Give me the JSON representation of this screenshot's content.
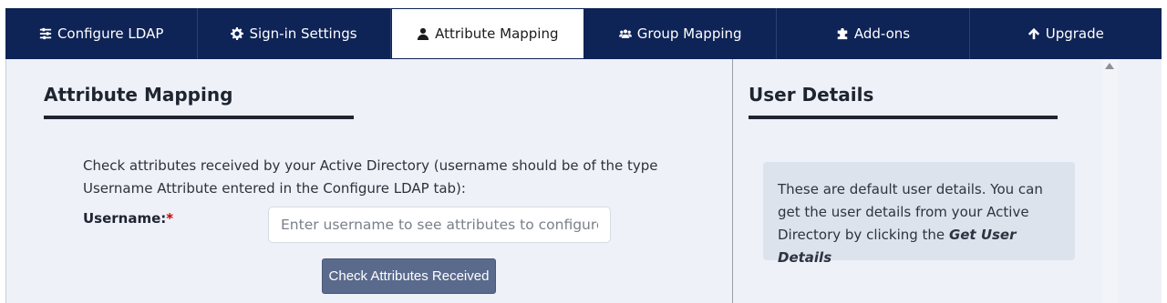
{
  "tabs": [
    {
      "label": "Configure LDAP",
      "icon": "sliders-icon"
    },
    {
      "label": "Sign-in Settings",
      "icon": "gear-icon"
    },
    {
      "label": "Attribute Mapping",
      "icon": "user-icon"
    },
    {
      "label": "Group Mapping",
      "icon": "users-icon"
    },
    {
      "label": "Add-ons",
      "icon": "puzzle-icon"
    },
    {
      "label": "Upgrade",
      "icon": "arrow-up-icon"
    }
  ],
  "active_tab": "Attribute Mapping",
  "main": {
    "title": "Attribute Mapping",
    "description": "Check attributes received by your Active Directory (username should be of the type Username Attribute entered in the Configure LDAP tab):",
    "username_label": "Username:",
    "required_mark": "*",
    "username_placeholder": "Enter username to see attributes to configure a",
    "username_value": "",
    "check_button": "Check Attributes Received"
  },
  "user_details": {
    "title": "User Details",
    "note_text": "These are default user details. You can get the user details from your Active Directory by clicking the ",
    "note_emphasis": "Get User Details"
  },
  "colors": {
    "tab_bar": "#0e2356",
    "panel_bg": "#eef1f8",
    "button": "#5a6a8c",
    "note_bg": "#dde3ed",
    "required": "#d00000"
  }
}
